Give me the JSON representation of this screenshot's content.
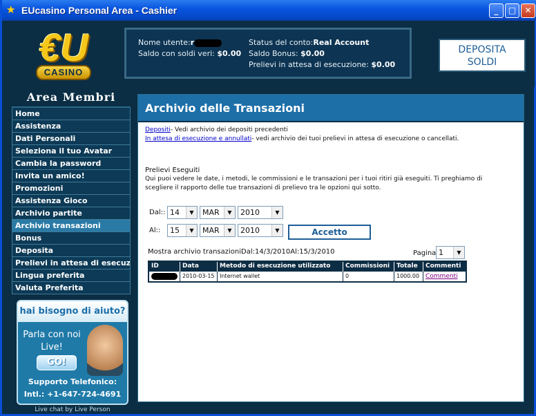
{
  "window": {
    "title": "EUcasino Personal Area - Cashier",
    "minimize": "_",
    "maximize": "□",
    "close": "✕"
  },
  "logo": {
    "eu": "€U",
    "casino": "CASINO"
  },
  "account": {
    "username_label": "Nome utente:",
    "username_value": "r",
    "real_balance_label": "Saldo con soldi veri:",
    "real_balance_value": "$0.00",
    "status_label": "Status del conto:",
    "status_value": "Real Account",
    "bonus_label": "Saldo Bonus:",
    "bonus_value": "$0.00",
    "pending_label": "Prelievi in attesa di esecuzione:",
    "pending_value": "$0.00"
  },
  "deposit_button": {
    "line1": "DEPOSITA",
    "line2": "SOLDI"
  },
  "sidebar": {
    "title": "Area Membri",
    "items": [
      {
        "label": "Home"
      },
      {
        "label": "Assistenza"
      },
      {
        "label": "Dati Personali"
      },
      {
        "label": "Seleziona il tuo Avatar"
      },
      {
        "label": "Cambia la password"
      },
      {
        "label": "Invita un amico!"
      },
      {
        "label": "Promozioni"
      },
      {
        "label": "Assistenza Gioco"
      },
      {
        "label": "Archivio partite"
      },
      {
        "label": "Archivio transazioni"
      },
      {
        "label": "Bonus"
      },
      {
        "label": "Deposita"
      },
      {
        "label": "Prelievi in attesa di esecuzione"
      },
      {
        "label": "Lingua preferita"
      },
      {
        "label": "Valuta Preferita"
      }
    ],
    "active_index": 9
  },
  "help": {
    "head": "hai bisogno di aiuto?",
    "talk": "Parla con noi Live!",
    "go": "GO!",
    "phone_label": "Supporto Telefonico:",
    "phone": "Intl.: +1-647-724-4691",
    "livechat": "Live chat by Live Person"
  },
  "main": {
    "title": "Archivio delle Transazioni",
    "link_deposits": "Depositi",
    "desc_deposits": "- Vedi archivio dei depositi precedenti",
    "link_pending": "In attesa di esecuzione e annullati",
    "desc_pending": "- vedi archivio dei tuoi prelievi in attesa di esecuzione o cancellati.",
    "section_title": "Prelievi Eseguiti",
    "section_desc": "Qui puoi vedere le date, i metodi, le commissioni e le transazioni per i tuoi ritiri già eseguiti. Ti preghiamo di scegliere il rapporto delle tue transazioni di prelievo tra le opzioni qui sotto.",
    "from_label": "Dal::",
    "to_label": "Al::",
    "from": {
      "day": "14",
      "month": "MAR",
      "year": "2010"
    },
    "to": {
      "day": "15",
      "month": "MAR",
      "year": "2010"
    },
    "accept": "Accetto",
    "showing": "Mostra archivio transazioniDal:14/3/2010Al:15/3/2010",
    "page_label": "Pagina",
    "page_value": "1",
    "table": {
      "headers": [
        "ID",
        "Data",
        "Metodo di esecuzione utilizzato",
        "Commissioni",
        "Totale",
        "Commenti"
      ],
      "rows": [
        {
          "id": "",
          "date": "2010-03-15",
          "method": "Internet wallet",
          "fees": "0",
          "total": "1000.00",
          "comments": "Commenti"
        }
      ]
    }
  }
}
